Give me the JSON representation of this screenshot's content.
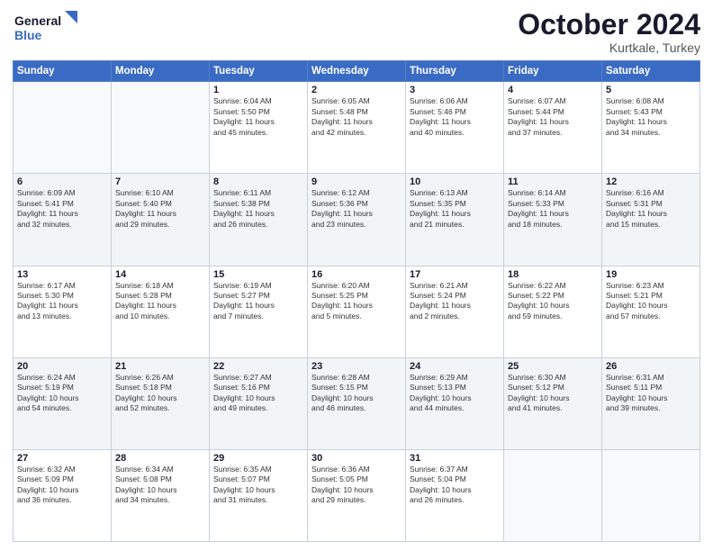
{
  "logo": {
    "line1": "General",
    "line2": "Blue"
  },
  "header": {
    "month": "October 2024",
    "location": "Kurtkale, Turkey"
  },
  "weekdays": [
    "Sunday",
    "Monday",
    "Tuesday",
    "Wednesday",
    "Thursday",
    "Friday",
    "Saturday"
  ],
  "weeks": [
    [
      {
        "day": "",
        "detail": ""
      },
      {
        "day": "",
        "detail": ""
      },
      {
        "day": "1",
        "detail": "Sunrise: 6:04 AM\nSunset: 5:50 PM\nDaylight: 11 hours\nand 45 minutes."
      },
      {
        "day": "2",
        "detail": "Sunrise: 6:05 AM\nSunset: 5:48 PM\nDaylight: 11 hours\nand 42 minutes."
      },
      {
        "day": "3",
        "detail": "Sunrise: 6:06 AM\nSunset: 5:46 PM\nDaylight: 11 hours\nand 40 minutes."
      },
      {
        "day": "4",
        "detail": "Sunrise: 6:07 AM\nSunset: 5:44 PM\nDaylight: 11 hours\nand 37 minutes."
      },
      {
        "day": "5",
        "detail": "Sunrise: 6:08 AM\nSunset: 5:43 PM\nDaylight: 11 hours\nand 34 minutes."
      }
    ],
    [
      {
        "day": "6",
        "detail": "Sunrise: 6:09 AM\nSunset: 5:41 PM\nDaylight: 11 hours\nand 32 minutes."
      },
      {
        "day": "7",
        "detail": "Sunrise: 6:10 AM\nSunset: 5:40 PM\nDaylight: 11 hours\nand 29 minutes."
      },
      {
        "day": "8",
        "detail": "Sunrise: 6:11 AM\nSunset: 5:38 PM\nDaylight: 11 hours\nand 26 minutes."
      },
      {
        "day": "9",
        "detail": "Sunrise: 6:12 AM\nSunset: 5:36 PM\nDaylight: 11 hours\nand 23 minutes."
      },
      {
        "day": "10",
        "detail": "Sunrise: 6:13 AM\nSunset: 5:35 PM\nDaylight: 11 hours\nand 21 minutes."
      },
      {
        "day": "11",
        "detail": "Sunrise: 6:14 AM\nSunset: 5:33 PM\nDaylight: 11 hours\nand 18 minutes."
      },
      {
        "day": "12",
        "detail": "Sunrise: 6:16 AM\nSunset: 5:31 PM\nDaylight: 11 hours\nand 15 minutes."
      }
    ],
    [
      {
        "day": "13",
        "detail": "Sunrise: 6:17 AM\nSunset: 5:30 PM\nDaylight: 11 hours\nand 13 minutes."
      },
      {
        "day": "14",
        "detail": "Sunrise: 6:18 AM\nSunset: 5:28 PM\nDaylight: 11 hours\nand 10 minutes."
      },
      {
        "day": "15",
        "detail": "Sunrise: 6:19 AM\nSunset: 5:27 PM\nDaylight: 11 hours\nand 7 minutes."
      },
      {
        "day": "16",
        "detail": "Sunrise: 6:20 AM\nSunset: 5:25 PM\nDaylight: 11 hours\nand 5 minutes."
      },
      {
        "day": "17",
        "detail": "Sunrise: 6:21 AM\nSunset: 5:24 PM\nDaylight: 11 hours\nand 2 minutes."
      },
      {
        "day": "18",
        "detail": "Sunrise: 6:22 AM\nSunset: 5:22 PM\nDaylight: 10 hours\nand 59 minutes."
      },
      {
        "day": "19",
        "detail": "Sunrise: 6:23 AM\nSunset: 5:21 PM\nDaylight: 10 hours\nand 57 minutes."
      }
    ],
    [
      {
        "day": "20",
        "detail": "Sunrise: 6:24 AM\nSunset: 5:19 PM\nDaylight: 10 hours\nand 54 minutes."
      },
      {
        "day": "21",
        "detail": "Sunrise: 6:26 AM\nSunset: 5:18 PM\nDaylight: 10 hours\nand 52 minutes."
      },
      {
        "day": "22",
        "detail": "Sunrise: 6:27 AM\nSunset: 5:16 PM\nDaylight: 10 hours\nand 49 minutes."
      },
      {
        "day": "23",
        "detail": "Sunrise: 6:28 AM\nSunset: 5:15 PM\nDaylight: 10 hours\nand 46 minutes."
      },
      {
        "day": "24",
        "detail": "Sunrise: 6:29 AM\nSunset: 5:13 PM\nDaylight: 10 hours\nand 44 minutes."
      },
      {
        "day": "25",
        "detail": "Sunrise: 6:30 AM\nSunset: 5:12 PM\nDaylight: 10 hours\nand 41 minutes."
      },
      {
        "day": "26",
        "detail": "Sunrise: 6:31 AM\nSunset: 5:11 PM\nDaylight: 10 hours\nand 39 minutes."
      }
    ],
    [
      {
        "day": "27",
        "detail": "Sunrise: 6:32 AM\nSunset: 5:09 PM\nDaylight: 10 hours\nand 36 minutes."
      },
      {
        "day": "28",
        "detail": "Sunrise: 6:34 AM\nSunset: 5:08 PM\nDaylight: 10 hours\nand 34 minutes."
      },
      {
        "day": "29",
        "detail": "Sunrise: 6:35 AM\nSunset: 5:07 PM\nDaylight: 10 hours\nand 31 minutes."
      },
      {
        "day": "30",
        "detail": "Sunrise: 6:36 AM\nSunset: 5:05 PM\nDaylight: 10 hours\nand 29 minutes."
      },
      {
        "day": "31",
        "detail": "Sunrise: 6:37 AM\nSunset: 5:04 PM\nDaylight: 10 hours\nand 26 minutes."
      },
      {
        "day": "",
        "detail": ""
      },
      {
        "day": "",
        "detail": ""
      }
    ]
  ]
}
